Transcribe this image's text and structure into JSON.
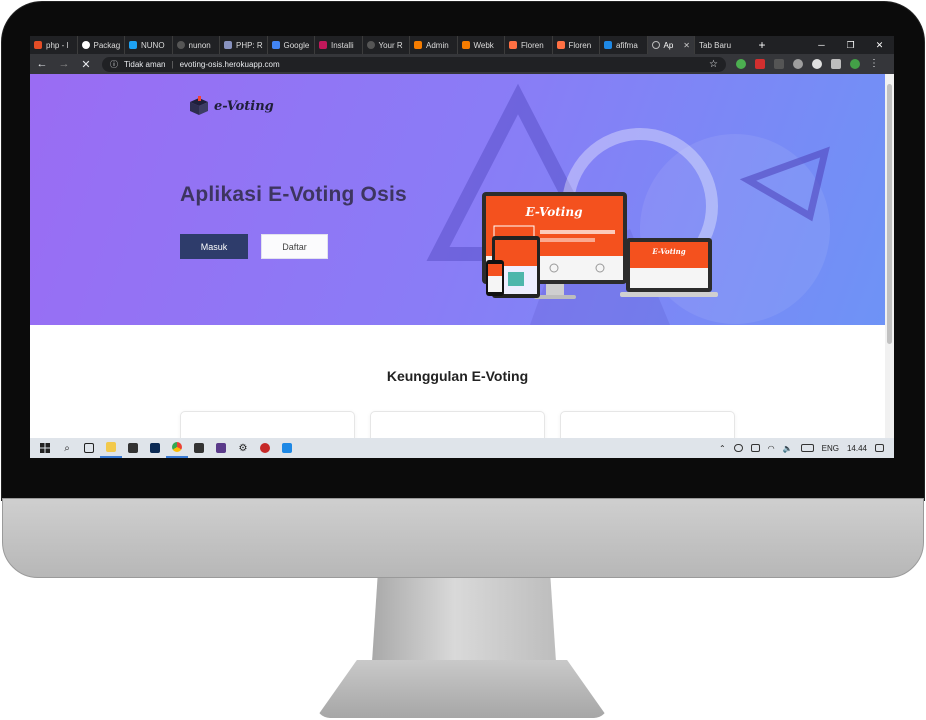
{
  "browser": {
    "tabs": [
      {
        "label": "php - l",
        "color": "#e44d26"
      },
      {
        "label": "Packag",
        "color": "#ffffff"
      },
      {
        "label": "NUNO",
        "color": "#1da1f2"
      },
      {
        "label": "nunon",
        "color": "#9aa0a6"
      },
      {
        "label": "PHP: R",
        "color": "#8892bf"
      },
      {
        "label": "Google",
        "color": "#4285f4"
      },
      {
        "label": "Installi",
        "color": "#c2185b"
      },
      {
        "label": "Your R",
        "color": "#9aa0a6"
      },
      {
        "label": "Admin",
        "color": "#f57c00"
      },
      {
        "label": "Webk",
        "color": "#f57c00"
      },
      {
        "label": "Floren",
        "color": "#ff7043"
      },
      {
        "label": "Floren",
        "color": "#ff7043"
      },
      {
        "label": "afifma",
        "color": "#1e88e5"
      },
      {
        "label": "Ap",
        "color": "#9aa0a6",
        "active": true
      },
      {
        "label": "Tab Baru",
        "color": "#35363a"
      }
    ],
    "new_tab": "+",
    "security_label": "Tidak aman",
    "url": "evoting-osis.herokuapp.com",
    "controls": {
      "minimize": "─",
      "maximize": "❐",
      "close": "✕"
    }
  },
  "page": {
    "logo_text": "e-Voting",
    "hero_title": "Aplikasi E-Voting Osis",
    "buttons": {
      "login": "Masuk",
      "register": "Daftar"
    },
    "mockup_label": "E-Voting",
    "section_title": "Keunggulan E-Voting"
  },
  "taskbar": {
    "language": "ENG",
    "time": "14.44"
  },
  "colors": {
    "hero_start": "#9a6cf3",
    "hero_end": "#6e93f6",
    "primary_button": "#2e3c6b",
    "mockup_accent": "#f4511e"
  }
}
